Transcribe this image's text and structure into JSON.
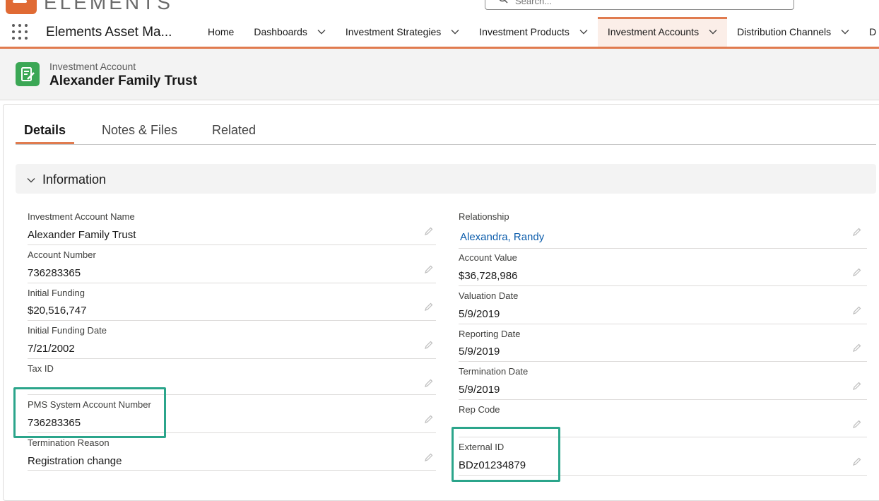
{
  "brand": {
    "logo_text": "ELEMENTS"
  },
  "search": {
    "placeholder": "Search..."
  },
  "nav": {
    "app_name": "Elements Asset Ma...",
    "items": [
      {
        "label": "Home"
      },
      {
        "label": "Dashboards"
      },
      {
        "label": "Investment Strategies"
      },
      {
        "label": "Investment Products"
      },
      {
        "label": "Investment Accounts"
      },
      {
        "label": "Distribution Channels"
      },
      {
        "label": "D"
      }
    ]
  },
  "record": {
    "type": "Investment Account",
    "title": "Alexander Family Trust"
  },
  "tabs": [
    {
      "label": "Details"
    },
    {
      "label": "Notes & Files"
    },
    {
      "label": "Related"
    }
  ],
  "section": {
    "title": "Information"
  },
  "fields_left": [
    {
      "label": "Investment Account Name",
      "value": "Alexander Family Trust"
    },
    {
      "label": "Account Number",
      "value": "736283365"
    },
    {
      "label": "Initial Funding",
      "value": "$20,516,747"
    },
    {
      "label": "Initial Funding Date",
      "value": "7/21/2002"
    },
    {
      "label": "Tax ID",
      "value": ""
    },
    {
      "label": "PMS System Account Number",
      "value": "736283365"
    },
    {
      "label": "Termination Reason",
      "value": "Registration change"
    }
  ],
  "fields_right": [
    {
      "label": "Relationship",
      "value": "Alexandra, Randy"
    },
    {
      "label": "Account Value",
      "value": "$36,728,986"
    },
    {
      "label": "Valuation Date",
      "value": "5/9/2019"
    },
    {
      "label": "Reporting Date",
      "value": "5/9/2019"
    },
    {
      "label": "Termination Date",
      "value": "5/9/2019"
    },
    {
      "label": "Rep Code",
      "value": ""
    },
    {
      "label": "External ID",
      "value": "BDz01234879"
    }
  ],
  "colors": {
    "accent": "#e07b4f",
    "record_icon": "#3ba755",
    "highlight": "#2ba58b",
    "link": "#0b5cab"
  }
}
